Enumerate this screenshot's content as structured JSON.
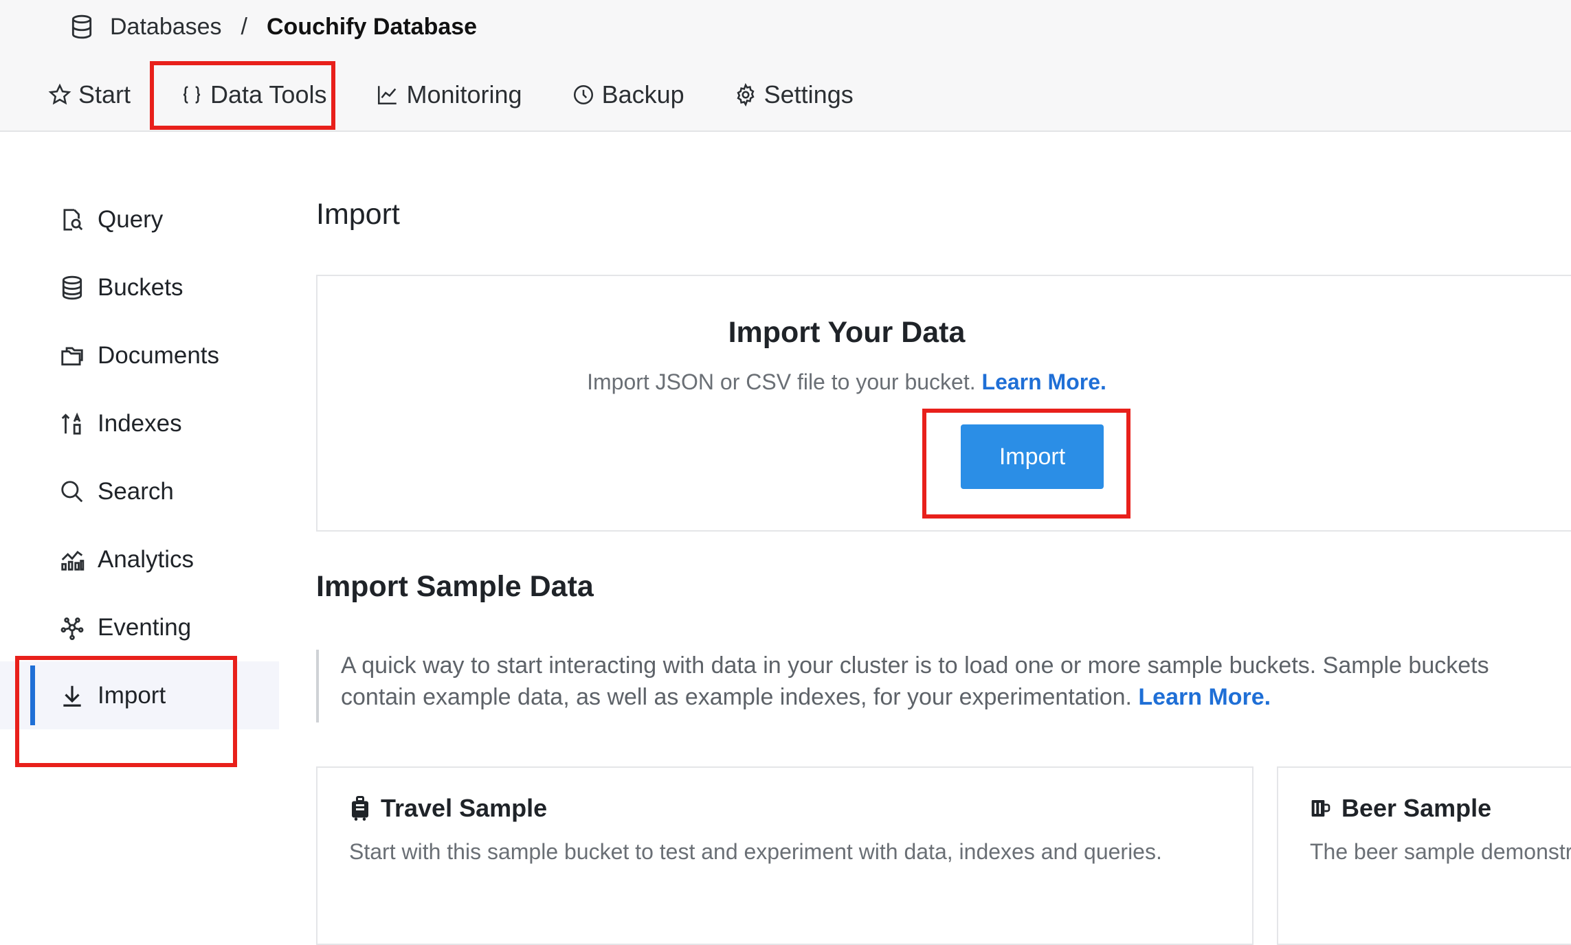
{
  "breadcrumb": {
    "icon": "database-icon",
    "parent": "Databases",
    "separator": "/",
    "current": "Couchify Database"
  },
  "tabs": [
    {
      "label": "Start",
      "icon": "star-icon"
    },
    {
      "label": "Data Tools",
      "icon": "braces-icon"
    },
    {
      "label": "Monitoring",
      "icon": "chart-line-icon"
    },
    {
      "label": "Backup",
      "icon": "clock-icon"
    },
    {
      "label": "Settings",
      "icon": "gear-icon"
    }
  ],
  "sidebar": {
    "items": [
      {
        "label": "Query",
        "icon": "query-doc-icon"
      },
      {
        "label": "Buckets",
        "icon": "database-icon"
      },
      {
        "label": "Documents",
        "icon": "folders-icon"
      },
      {
        "label": "Indexes",
        "icon": "sort-icon"
      },
      {
        "label": "Search",
        "icon": "search-icon"
      },
      {
        "label": "Analytics",
        "icon": "analytics-icon"
      },
      {
        "label": "Eventing",
        "icon": "eventing-icon"
      },
      {
        "label": "Import",
        "icon": "download-icon",
        "active": true
      }
    ]
  },
  "main": {
    "title": "Import",
    "import_card": {
      "heading": "Import Your Data",
      "subtitle": "Import JSON or CSV file to your bucket.",
      "learn_more": "Learn More.",
      "button": "Import"
    },
    "sample_section": {
      "title": "Import Sample Data",
      "description": "A quick way to start interacting with data in your cluster is to load one or more sample buckets. Sample buckets contain example data, as well as example indexes, for your experimentation.",
      "learn_more": "Learn More."
    },
    "samples": [
      {
        "title": "Travel Sample",
        "icon": "luggage-icon",
        "description": "Start with this sample bucket to test and experiment with data, indexes and queries."
      },
      {
        "title": "Beer Sample",
        "icon": "beer-icon",
        "description": "The beer sample demonstrates"
      }
    ]
  },
  "colors": {
    "accent": "#1f6fd6",
    "button": "#2b8ee6",
    "highlight": "#e8201b"
  }
}
